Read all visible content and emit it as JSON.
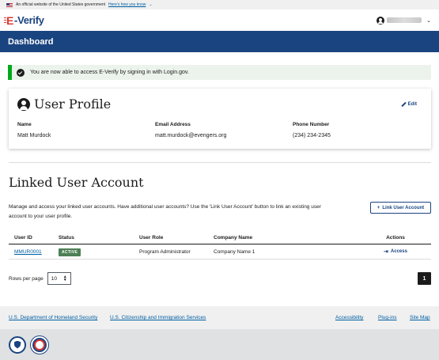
{
  "gov_banner": {
    "text": "An official website of the United States government",
    "link": "Here's how you know"
  },
  "header": {
    "logo_e": "E",
    "logo_rest": "-Verify"
  },
  "nav": {
    "title": "Dashboard"
  },
  "alert": {
    "message": "You are now able to access E-Verify by signing in with Login.gov."
  },
  "profile": {
    "title": "User Profile",
    "edit_label": "Edit",
    "fields": [
      {
        "label": "Name",
        "value": "Matt Murdock"
      },
      {
        "label": "Email Address",
        "value": "matt.murdock@evengers.org"
      },
      {
        "label": "Phone Number",
        "value": "(234) 234-2345"
      }
    ]
  },
  "linked": {
    "title": "Linked User Account",
    "description": "Manage and access your linked user accounts. Have additional user accounts? Use the 'Link User Account' button to link an existing user account to your user profile.",
    "link_button": "Link User Account",
    "columns": [
      "User ID",
      "Status",
      "User Role",
      "Company Name",
      "Actions"
    ],
    "rows": [
      {
        "user_id": "MMUR0001",
        "status": "ACTIVE",
        "role": "Program Administrator",
        "company": "Company Name 1",
        "action": "Access"
      }
    ],
    "rows_per_page_label": "Rows per page",
    "rows_per_page_value": "10",
    "current_page": "1"
  },
  "footer": {
    "dhs": "U.S. Department of Homeland Security",
    "uscis": "U.S. Citizenship and Immigration Services",
    "accessibility": "Accessibility",
    "plugins": "Plug-ins",
    "sitemap": "Site Map"
  },
  "colors": {
    "primary": "#1a4480",
    "link": "#005ea2",
    "success": "#00a91c",
    "status_active": "#4d8055",
    "logo_red": "#d83933"
  },
  "icons": [
    "us-flag-icon",
    "chevron-down-icon",
    "user-circle-icon",
    "check-circle-icon",
    "pencil-icon",
    "plus-icon",
    "login-icon",
    "dhs-seal-icon",
    "uscis-seal-icon"
  ]
}
